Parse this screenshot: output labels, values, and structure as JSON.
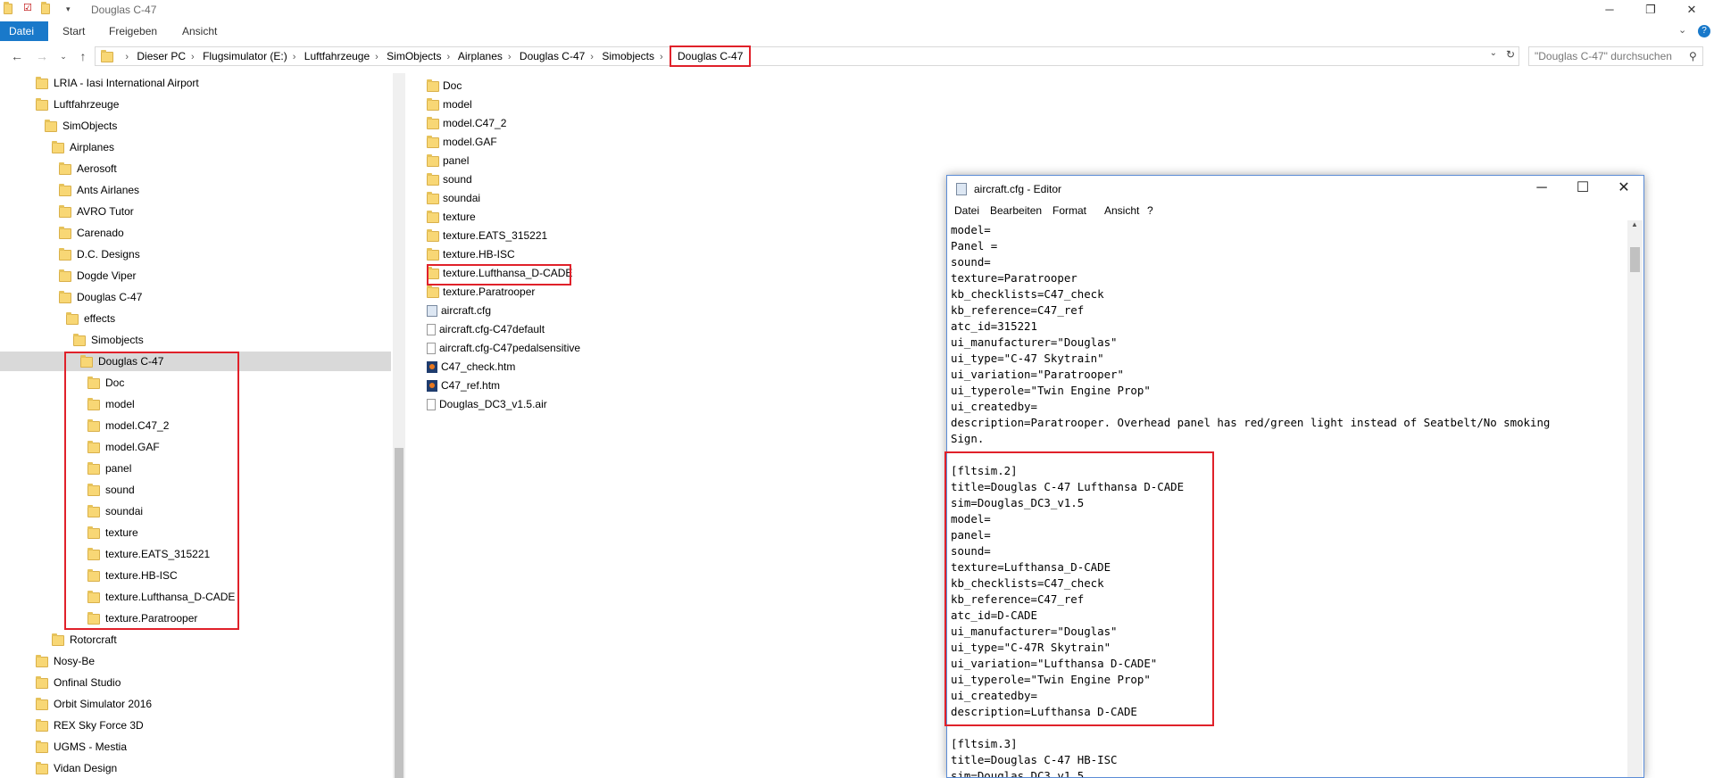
{
  "window": {
    "title": "Douglas C-47"
  },
  "ribbon": {
    "tabs": [
      "Datei",
      "Start",
      "Freigeben",
      "Ansicht"
    ],
    "active": "Datei"
  },
  "address": {
    "crumbs": [
      "Dieser PC",
      "Flugsimulator (E:)",
      "Luftfahrzeuge",
      "SimObjects",
      "Airplanes",
      "Douglas C-47",
      "Simobjects",
      "Douglas C-47"
    ],
    "search_placeholder": "\"Douglas C-47\" durchsuchen"
  },
  "tree": [
    "LRIA - Iasi International Airport",
    "Luftfahrzeuge",
    "SimObjects",
    "Airplanes",
    "Aerosoft",
    "Ants Airlanes",
    "AVRO Tutor",
    "Carenado",
    "D.C. Designs",
    "Dogde Viper",
    "Douglas C-47",
    "effects",
    "Simobjects",
    "Douglas C-47",
    "Doc",
    "model",
    "model.C47_2",
    "model.GAF",
    "panel",
    "sound",
    "soundai",
    "texture",
    "texture.EATS_315221",
    "texture.HB-ISC",
    "texture.Lufthansa_D-CADE",
    "texture.Paratrooper",
    "Rotorcraft",
    "Nosy-Be",
    "Onfinal Studio",
    "Orbit Simulator 2016",
    "REX Sky Force 3D",
    "UGMS - Mestia",
    "Vidan Design"
  ],
  "files": [
    "Doc",
    "model",
    "model.C47_2",
    "model.GAF",
    "panel",
    "sound",
    "soundai",
    "texture",
    "texture.EATS_315221",
    "texture.HB-ISC",
    "texture.Lufthansa_D-CADE",
    "texture.Paratrooper",
    "aircraft.cfg",
    "aircraft.cfg-C47default",
    "aircraft.cfg-C47pedalsensitive",
    "C47_check.htm",
    "C47_ref.htm",
    "Douglas_DC3_v1.5.air"
  ],
  "notepad": {
    "title": "aircraft.cfg - Editor",
    "menu": [
      "Datei",
      "Bearbeiten",
      "Format",
      "Ansicht",
      "?"
    ],
    "lines": [
      "model=",
      "Panel =",
      "sound=",
      "texture=Paratrooper",
      "kb_checklists=C47_check",
      "kb_reference=C47_ref",
      "atc_id=315221",
      "ui_manufacturer=\"Douglas\"",
      "ui_type=\"C-47 Skytrain\"",
      "ui_variation=\"Paratrooper\"",
      "ui_typerole=\"Twin Engine Prop\"",
      "ui_createdby=",
      "description=Paratrooper. Overhead panel has red/green light instead of Seatbelt/No smoking",
      "Sign.",
      "",
      "[fltsim.2]",
      "title=Douglas C-47 Lufthansa D-CADE",
      "sim=Douglas_DC3_v1.5",
      "model=",
      "panel=",
      "sound=",
      "texture=Lufthansa_D-CADE",
      "kb_checklists=C47_check",
      "kb_reference=C47_ref",
      "atc_id=D-CADE",
      "ui_manufacturer=\"Douglas\"",
      "ui_type=\"C-47R Skytrain\"",
      "ui_variation=\"Lufthansa D-CADE\"",
      "ui_typerole=\"Twin Engine Prop\"",
      "ui_createdby=",
      "description=Lufthansa D-CADE",
      "",
      "[fltsim.3]",
      "title=Douglas C-47 HB-ISC",
      "sim=Douglas_DC3_v1.5"
    ]
  }
}
